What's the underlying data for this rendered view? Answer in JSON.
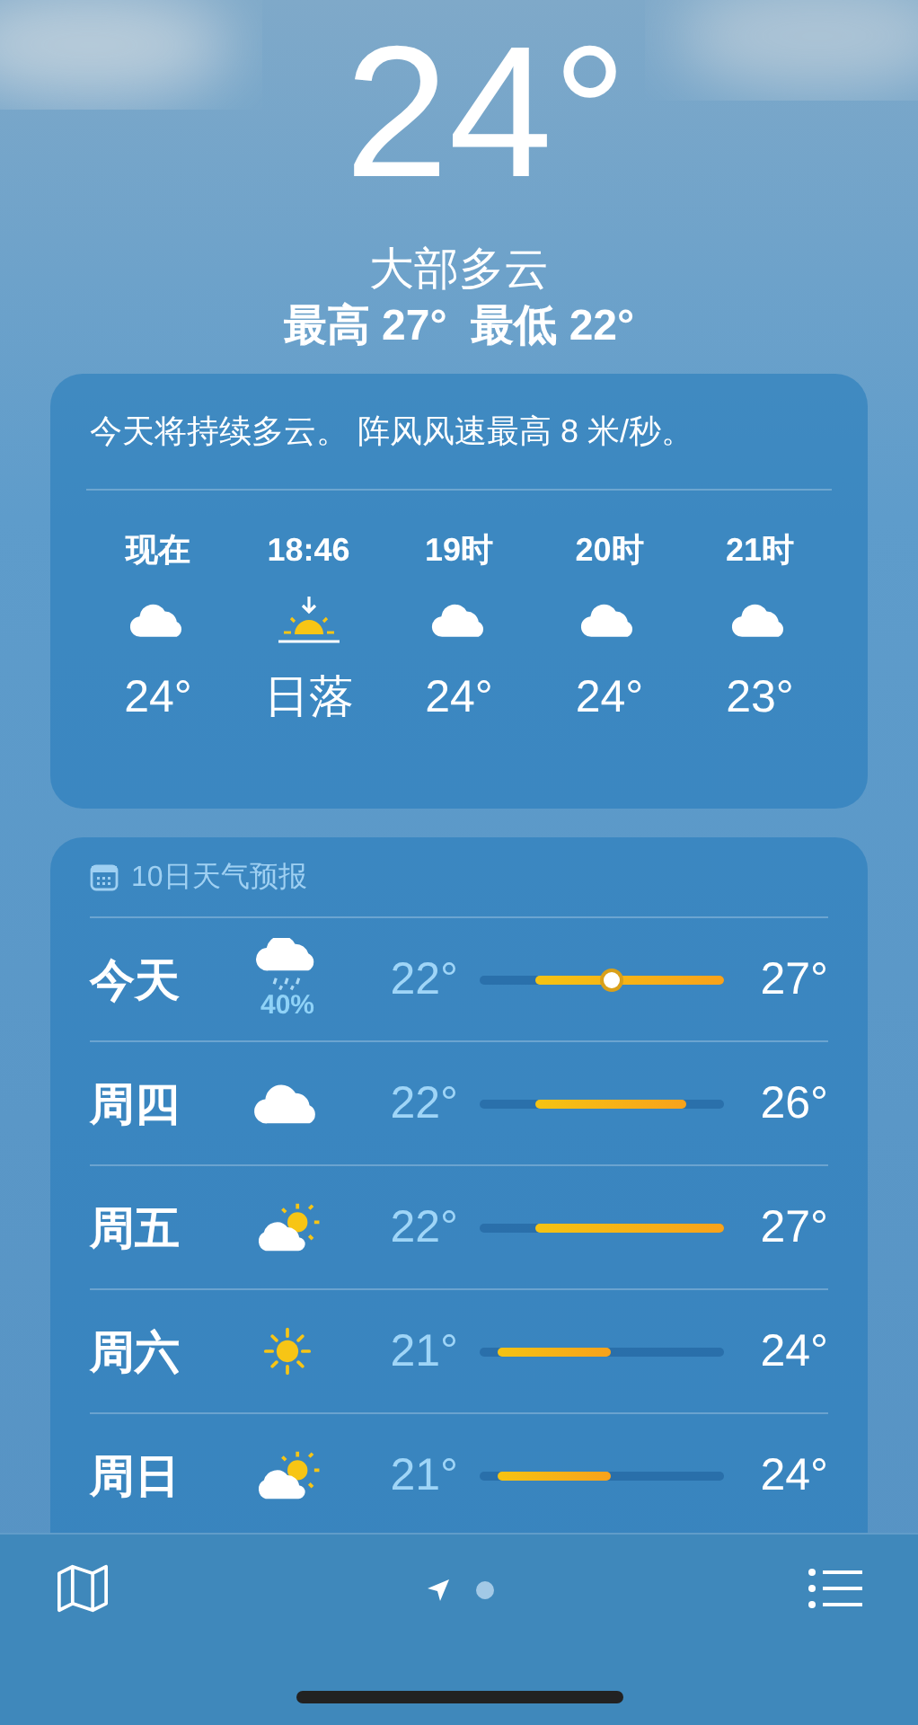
{
  "current": {
    "temperature": "24°",
    "condition": "大部多云",
    "high_low": "最高 27°  最低 22°"
  },
  "hourly_card": {
    "summary": "今天将持续多云。 阵风风速最高 8 米/秒。",
    "hours": [
      {
        "time": "现在",
        "kind": "cloud",
        "value": "24°"
      },
      {
        "time": "18:46",
        "kind": "sunset",
        "value": "日落"
      },
      {
        "time": "19时",
        "kind": "cloud",
        "value": "24°"
      },
      {
        "time": "20时",
        "kind": "cloud",
        "value": "24°"
      },
      {
        "time": "21时",
        "kind": "cloud",
        "value": "23°"
      }
    ]
  },
  "forecast_card": {
    "title": "10日天气预报",
    "days": [
      {
        "day": "今天",
        "kind": "rain",
        "precipitation": "40%",
        "low": "22°",
        "high": "27°",
        "now_marker": true
      },
      {
        "day": "周四",
        "kind": "cloud",
        "low": "22°",
        "high": "26°",
        "now_marker": false
      },
      {
        "day": "周五",
        "kind": "partly-sunny",
        "low": "22°",
        "high": "27°",
        "now_marker": false
      },
      {
        "day": "周六",
        "kind": "sun",
        "low": "21°",
        "high": "24°",
        "now_marker": false
      },
      {
        "day": "周日",
        "kind": "partly-sunny",
        "low": "21°",
        "high": "24°",
        "now_marker": false
      }
    ]
  }
}
